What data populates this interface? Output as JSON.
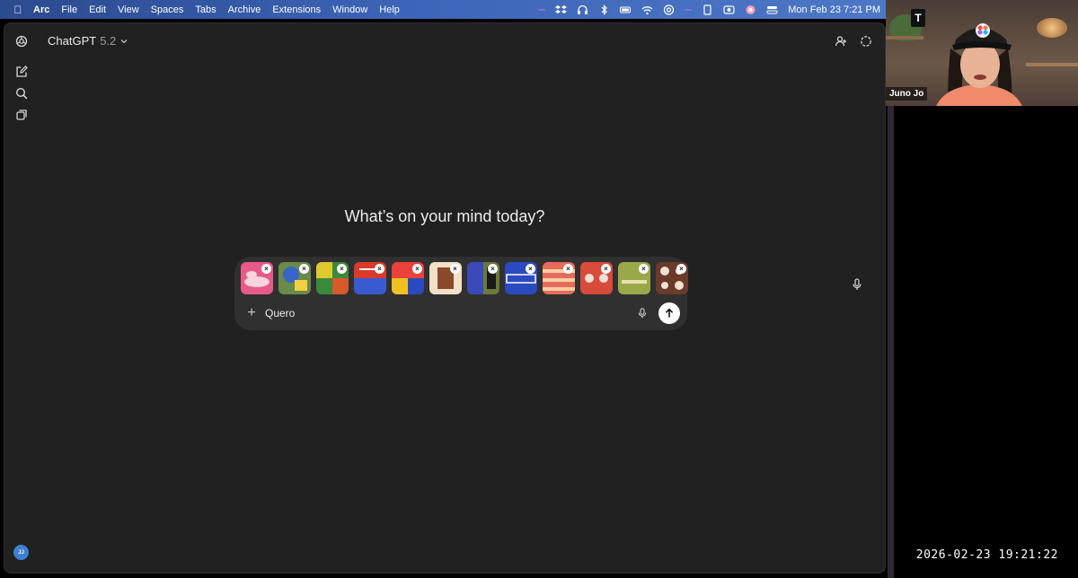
{
  "menubar": {
    "app_name": "Arc",
    "items": [
      "File",
      "Edit",
      "View",
      "Spaces",
      "Tabs",
      "Archive",
      "Extensions",
      "Window",
      "Help"
    ],
    "clock": "Mon Feb 23  7:21 PM"
  },
  "header": {
    "model_name": "ChatGPT",
    "model_version": "5.2"
  },
  "main": {
    "headline": "What’s on your mind today?"
  },
  "composer": {
    "input_value": "Quero",
    "attachments": [
      {
        "bg": "#e85a8a",
        "fg": "#f7d4de"
      },
      {
        "bg": "#6a8a4a",
        "fg": "#3a64c8"
      },
      {
        "bg": "#3b8a3c",
        "fg": "#e0c830"
      },
      {
        "bg": "#d93a2a",
        "fg": "#3a5ad0"
      },
      {
        "bg": "#e8423a",
        "fg": "#f0c020"
      },
      {
        "bg": "#f2e0c8",
        "fg": "#8a4a2a"
      },
      {
        "bg": "#6a7a3a",
        "fg": "#3a4ab8"
      },
      {
        "bg": "#2a4ac0",
        "fg": "#ffffff"
      },
      {
        "bg": "#e86a5a",
        "fg": "#f2d0a0"
      },
      {
        "bg": "#d84a3a",
        "fg": "#f2e0d0"
      },
      {
        "bg": "#9aa84a",
        "fg": "#e8e0b0"
      },
      {
        "bg": "#6a3a2a",
        "fg": "#f0e0d0"
      }
    ]
  },
  "user": {
    "avatar_initials": "JJ"
  },
  "webcam": {
    "participant_name": "Juno Jo",
    "logo_letter": "T"
  },
  "recording_timestamp": "2026-02-23  19:21:22",
  "colors": {
    "window_bg": "#212121",
    "composer_bg": "#303030",
    "accent_avatar": "#3f7fd1"
  }
}
